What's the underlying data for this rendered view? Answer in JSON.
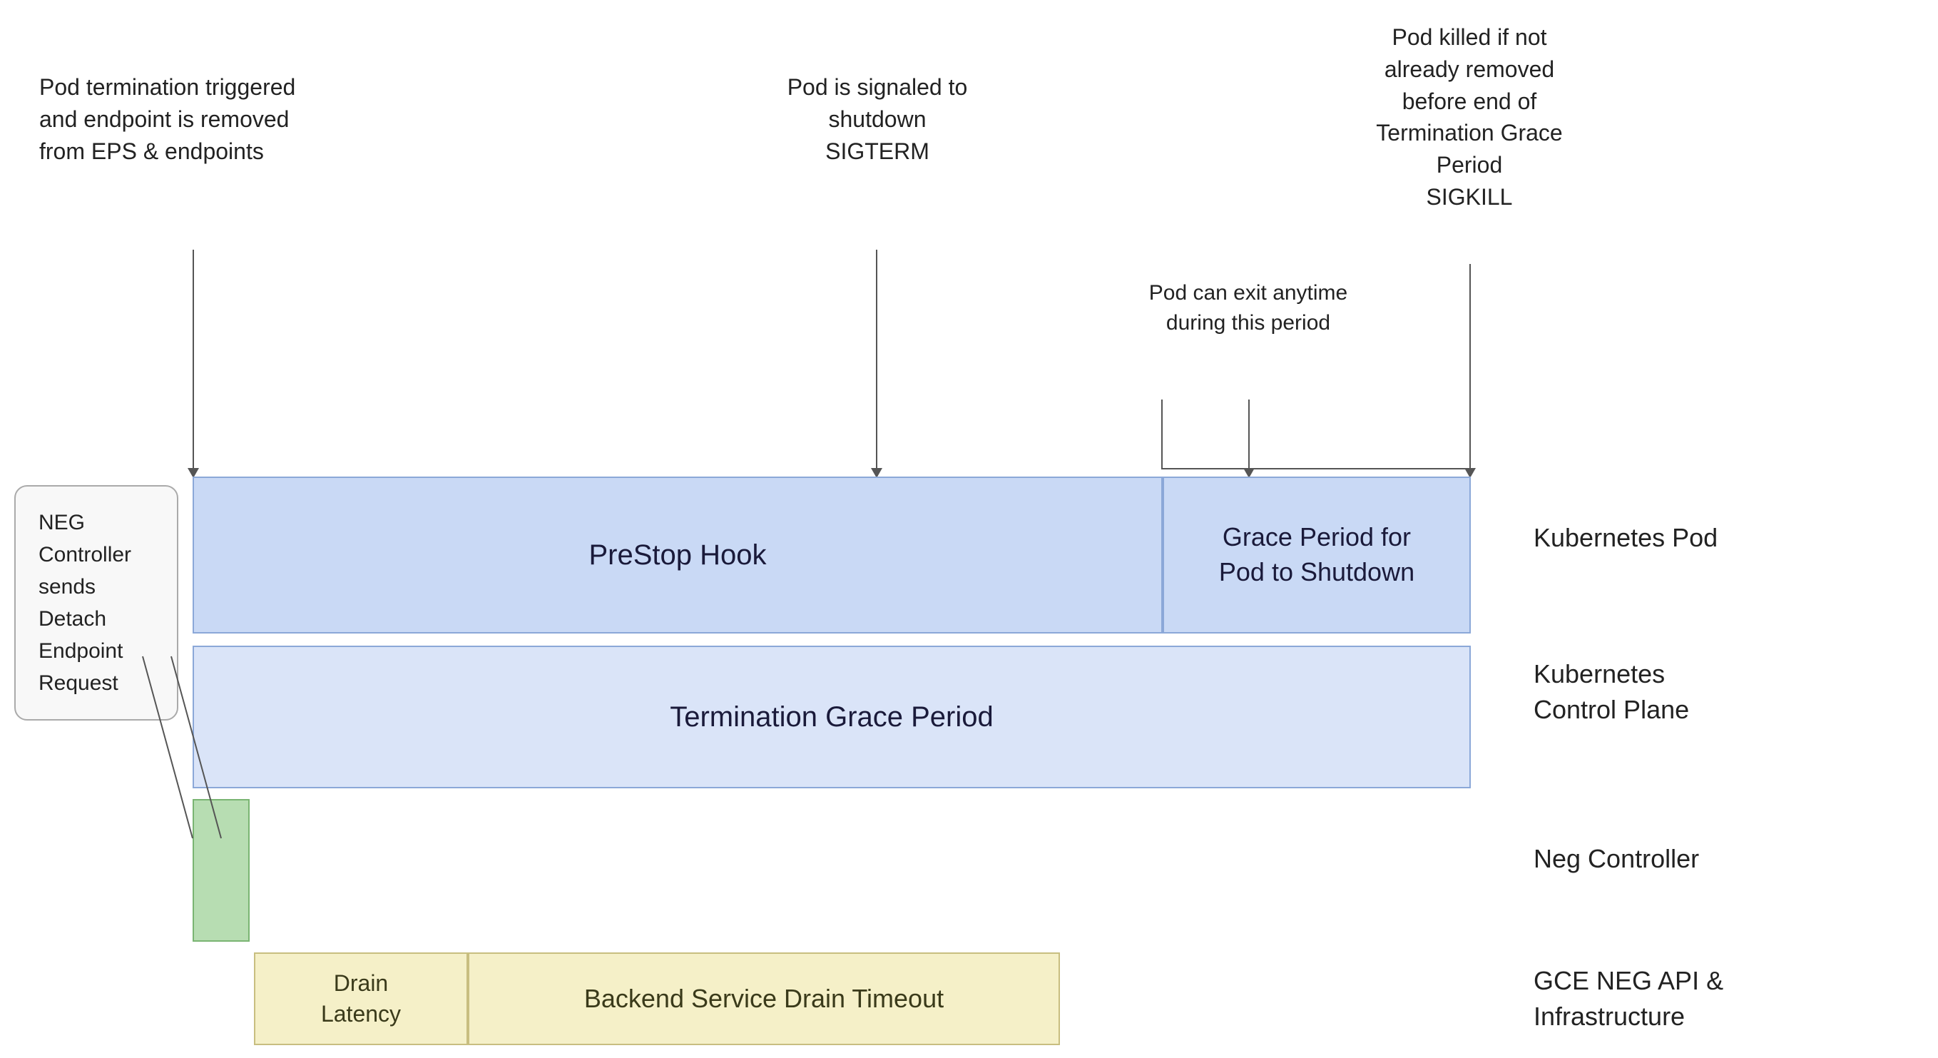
{
  "annotations": {
    "pod_termination": {
      "text": "Pod termination triggered\nand endpoint is removed\nfrom EPS & endpoints",
      "lines": [
        "Pod termination triggered",
        "and endpoint is removed",
        "from EPS & endpoints"
      ]
    },
    "pod_signaled": {
      "text": "Pod is signaled to\nshutdown\nSIGTERM",
      "lines": [
        "Pod is signaled to",
        "shutdown",
        "SIGTERM"
      ]
    },
    "pod_killed": {
      "text": "Pod killed if not\nalready removed\nbefore end of\nTermination Grace\nPeriod\nSIGKILL",
      "lines": [
        "Pod killed if not",
        "already removed",
        "before end of",
        "Termination Grace",
        "Period",
        "SIGKILL"
      ]
    },
    "pod_can_exit": {
      "text": "Pod can exit anytime\nduring this period",
      "lines": [
        "Pod can exit anytime",
        "during this period"
      ]
    }
  },
  "boxes": {
    "prestop_hook": "PreStop Hook",
    "grace_period": "Grace Period for\nPod to Shutdown",
    "termination_grace": "Termination Grace Period",
    "drain_latency": "Drain\nLatency",
    "backend_drain": "Backend Service Drain Timeout"
  },
  "row_labels": {
    "kubernetes_pod": [
      "Kubernetes Pod"
    ],
    "kubernetes_control": [
      "Kubernetes",
      "Control Plane"
    ],
    "neg_controller": [
      "Neg Controller"
    ],
    "gce_neg": [
      "GCE NEG API &",
      "Infrastructure"
    ]
  },
  "neg_bubble": {
    "lines": [
      "NEG",
      "Controller",
      "sends",
      "Detach",
      "Endpoint",
      "Request"
    ]
  }
}
